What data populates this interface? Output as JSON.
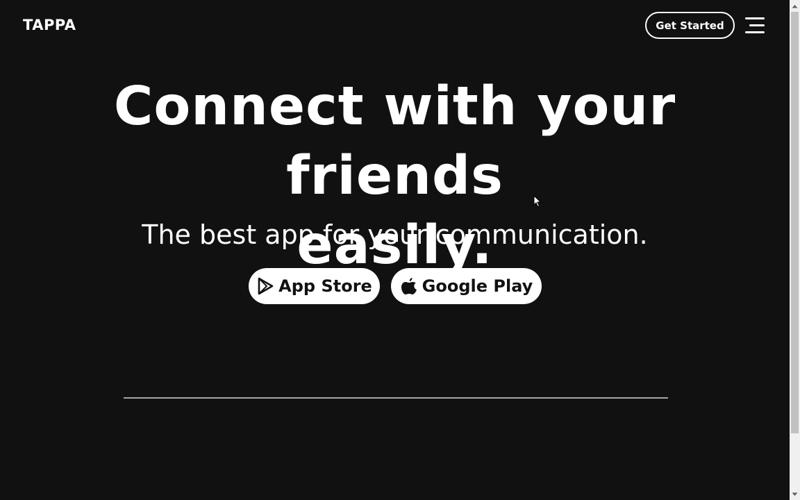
{
  "header": {
    "logo": "TAPPA",
    "cta_label": "Get Started",
    "menu_icon": "hamburger-menu-icon"
  },
  "hero": {
    "title_line1": "Connect with your friends",
    "title_line2": "easily.",
    "subtitle": "The best app for your communication."
  },
  "buttons": {
    "app_store": {
      "label": "App Store",
      "icon": "play-triangle-icon"
    },
    "google_play": {
      "label": "Google Play",
      "icon": "apple-icon"
    }
  },
  "colors": {
    "background": "#111111",
    "text": "#ffffff",
    "button_bg": "#ffffff",
    "button_text": "#111111",
    "divider": "#a6a6a6"
  }
}
